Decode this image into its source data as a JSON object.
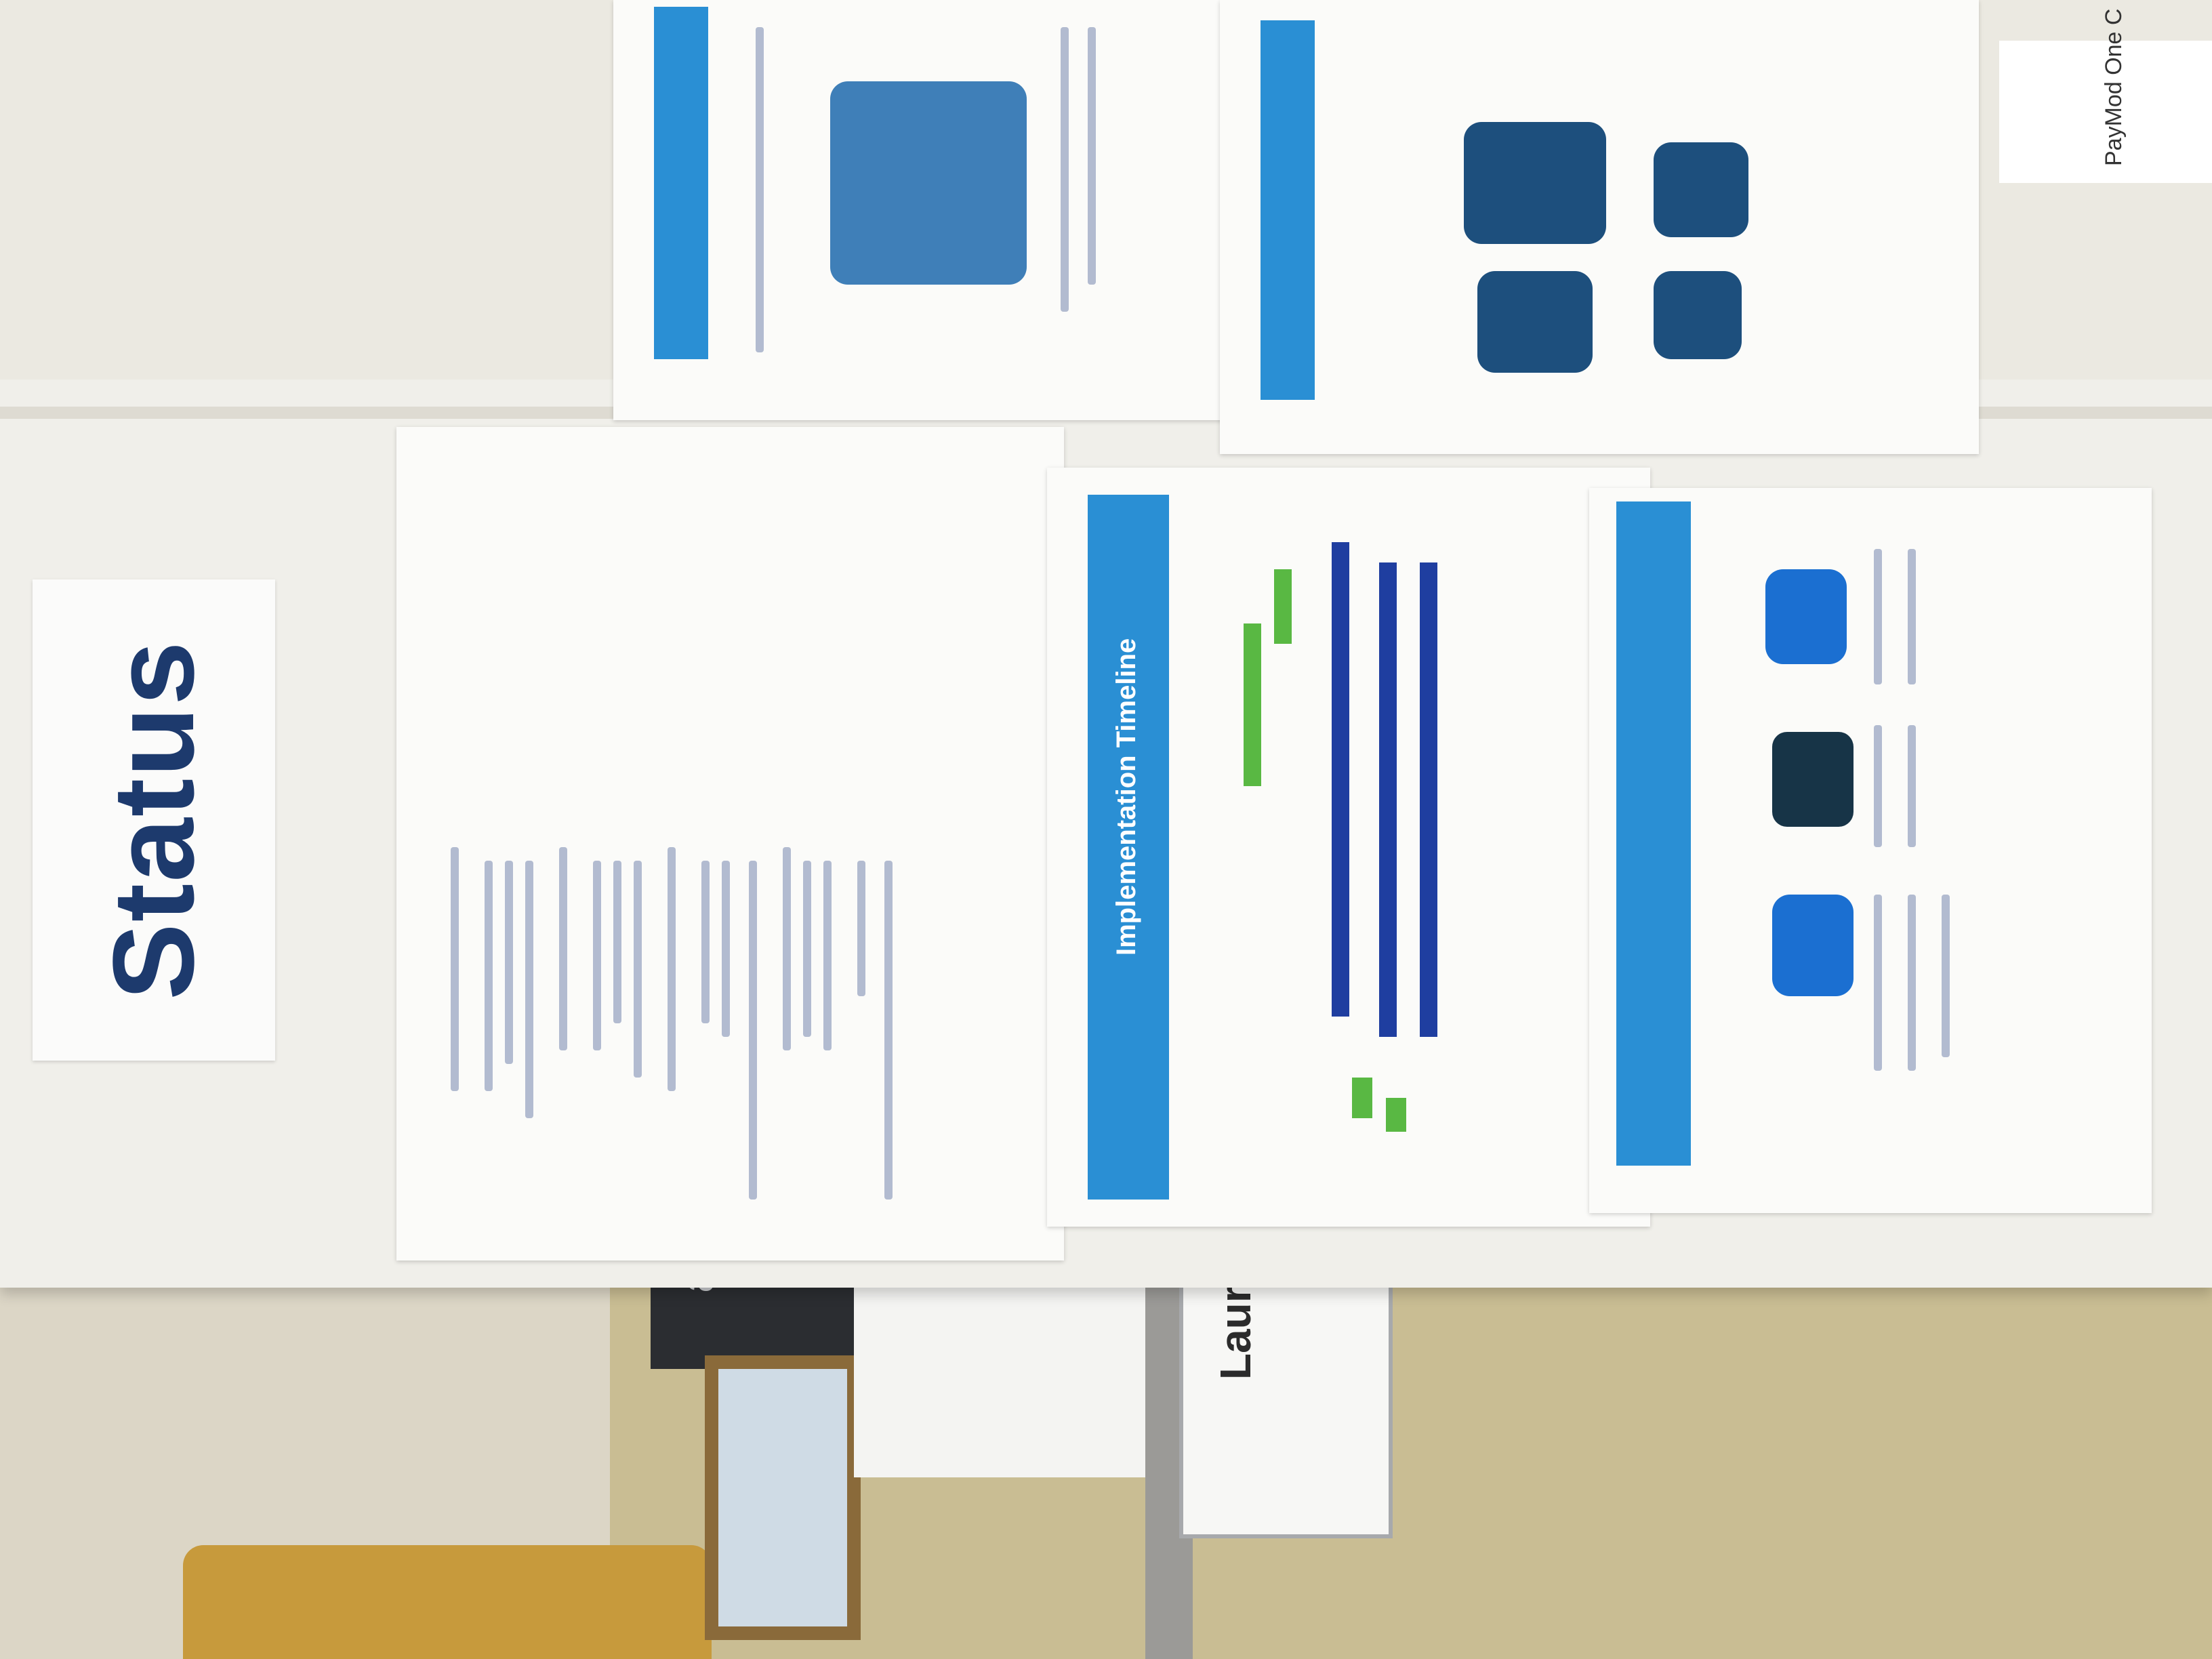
{
  "scene": {
    "sign": {
      "label": "Status"
    },
    "timeline_poster": {
      "title": "Implementation Timeline"
    },
    "nameplate": {
      "text": "Lauren"
    },
    "monitor": {
      "text": "ac"
    },
    "corner_note": {
      "text": "PayMod One C"
    }
  },
  "colors": {
    "wall": "#dcd6c6",
    "board": "#f0efea",
    "sign_text": "#1d3a6d",
    "poster_blue": "#2a8fd4",
    "timeline_green": "#59b843",
    "timeline_navy": "#1f3ea0",
    "cubicle": "#c9bd93"
  }
}
